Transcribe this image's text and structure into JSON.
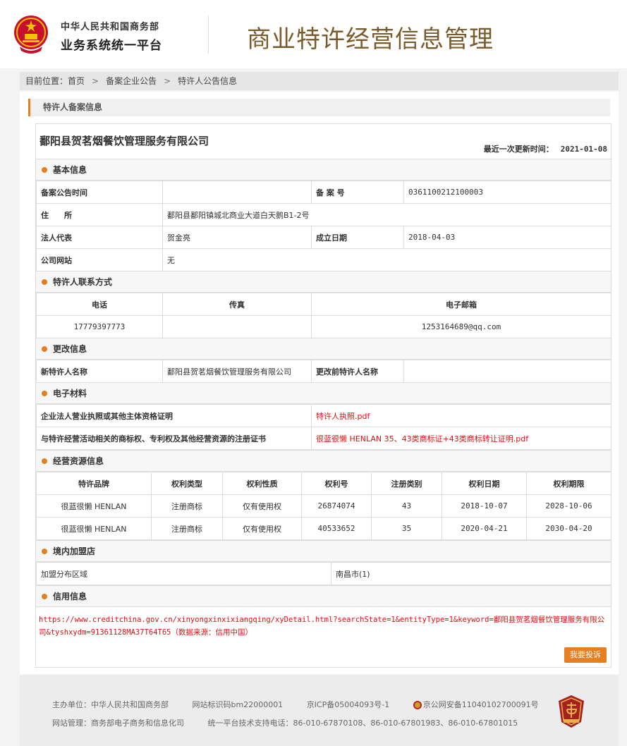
{
  "header": {
    "org_line1": "中华人民共和国商务部",
    "org_line2": "业务系统统一平台",
    "site_title": "商业特许经营信息管理"
  },
  "breadcrumb": {
    "prefix": "目前位置：",
    "items": [
      "首页",
      "备案企业公告",
      "特许人公告信息"
    ]
  },
  "panel_title": "特许人备案信息",
  "company": {
    "name": "鄱阳县贺茗烟餐饮管理服务有限公司",
    "updated_label": "最近一次更新时间：",
    "updated_date": "2021-01-08"
  },
  "basic": {
    "title": "基本信息",
    "announce_time_label": "备案公告时间",
    "announce_time_value": "",
    "record_no_label": "备 案 号",
    "record_no_value": "0361100212100003",
    "address_label": "住　　所",
    "address_value": "鄱阳县鄱阳镇城北商业大道白天鹅B1-2号",
    "legal_rep_label": "法人代表",
    "legal_rep_value": "贺金亮",
    "est_date_label": "成立日期",
    "est_date_value": "2018-04-03",
    "website_label": "公司网站",
    "website_value": "无"
  },
  "contact": {
    "title": "特许人联系方式",
    "headers": [
      "电话",
      "传真",
      "电子邮箱"
    ],
    "phone": "17779397773",
    "fax": "",
    "email": "1253164689@qq.com"
  },
  "changes": {
    "title": "更改信息",
    "new_name_label": "新特许人名称",
    "new_name_value": "鄱阳县贺茗烟餐饮管理服务有限公司",
    "old_name_label": "更改前特许人名称",
    "old_name_value": ""
  },
  "materials": {
    "title": "电子材料",
    "license_label": "企业法人营业执照或其他主体资格证明",
    "license_file": "特许人执照.pdf",
    "trademark_label": "与特许经营活动相关的商标权、专利权及其他经营资源的注册证书",
    "trademark_file": "很蓝很懒 HENLAN 35、43类商标证+43类商标转让证明.pdf"
  },
  "resources": {
    "title": "经营资源信息",
    "headers": [
      "特许品牌",
      "权利类型",
      "权利性质",
      "权利号",
      "注册类别",
      "权利日期",
      "权利期限"
    ],
    "rows": [
      {
        "brand": "很蓝很懒 HENLAN",
        "type": "注册商标",
        "nature": "仅有使用权",
        "number": "26874074",
        "category": "43",
        "date": "2018-10-07",
        "term": "2028-10-06"
      },
      {
        "brand": "很蓝很懒 HENLAN",
        "type": "注册商标",
        "nature": "仅有使用权",
        "number": "40533652",
        "category": "35",
        "date": "2020-04-21",
        "term": "2030-04-20"
      }
    ]
  },
  "stores": {
    "title": "境内加盟店",
    "region_label": "加盟分布区域",
    "region_value": "南昌市(1)"
  },
  "credit": {
    "title": "信用信息",
    "link_text": "https://www.creditchina.gov.cn/xinyongxinxixiangqing/xyDetail.html?searchState=1&entityType=1&keyword=鄱阳县贺茗烟餐饮管理服务有限公司&tyshxydm=91361128MA37T64T65（数据来源：信用中国）",
    "report_button": "我要投诉"
  },
  "footer": {
    "sponsor": "主办单位：中华人民共和国商务部",
    "site_id": "网站标识码bm22000001",
    "icp": "京ICP备05004093号-1",
    "police": "京公网安备11040102700091号",
    "manager": "网站管理：商务部电子商务和信息化司",
    "support": "统一平台技术支持电话：86-010-67870108、86-010-67801983、86-010-67801015"
  },
  "colors": {
    "accent": "#e67e22",
    "title_brown": "#7a5a2a",
    "link_red": "#dd1111"
  },
  "icons": [
    "national-emblem-icon",
    "bullet-dot-icon",
    "police-badge-icon",
    "gov-error-correction-icon"
  ]
}
